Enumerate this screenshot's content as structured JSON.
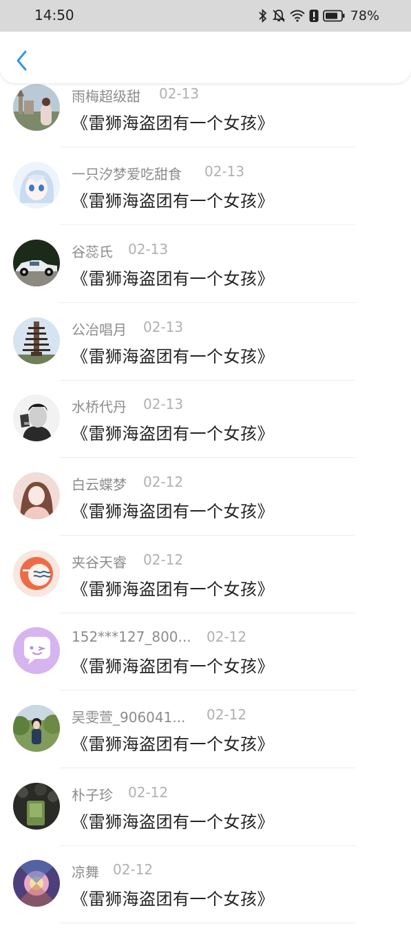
{
  "status_bar": {
    "time": "14:50",
    "battery": "78%",
    "icons": [
      "bluetooth-icon",
      "mute-icon",
      "wifi-icon",
      "alert-icon",
      "battery-icon"
    ]
  },
  "header": {
    "back_icon": "chevron-left-icon",
    "accent": "#2f96e8"
  },
  "items": [
    {
      "name": "雨梅超级甜",
      "date": "02-13",
      "title": "《雷狮海盗团有一个女孩》",
      "avatar": "castle-photo"
    },
    {
      "name": "一只汐梦爱吃甜食",
      "date": "02-13",
      "title": "《雷狮海盗团有一个女孩》",
      "avatar": "anime-girl"
    },
    {
      "name": "谷蕊氏",
      "date": "02-13",
      "title": "《雷狮海盗团有一个女孩》",
      "avatar": "vintage-car"
    },
    {
      "name": "公冶唱月",
      "date": "02-13",
      "title": "《雷狮海盗团有一个女孩》",
      "avatar": "pagoda"
    },
    {
      "name": "水桥代丹",
      "date": "02-13",
      "title": "《雷狮海盗团有一个女孩》",
      "avatar": "man-portrait"
    },
    {
      "name": "白云蝶梦",
      "date": "02-12",
      "title": "《雷狮海盗团有一个女孩》",
      "avatar": "woman-portrait"
    },
    {
      "name": "夹谷天睿",
      "date": "02-12",
      "title": "《雷狮海盗团有一个女孩》",
      "avatar": "orange-logo"
    },
    {
      "name": "152***127_800...",
      "date": "02-12",
      "title": "《雷狮海盗团有一个女孩》",
      "avatar": "chat-bubble"
    },
    {
      "name": "吴雯萱_906041...",
      "date": "02-12",
      "title": "《雷狮海盗团有一个女孩》",
      "avatar": "outdoor-girl"
    },
    {
      "name": "朴子珍",
      "date": "02-12",
      "title": "《雷狮海盗团有一个女孩》",
      "avatar": "dark-photo"
    },
    {
      "name": "凉舞",
      "date": "02-12",
      "title": "《雷狮海盗团有一个女孩》",
      "avatar": "colorful-art"
    }
  ]
}
